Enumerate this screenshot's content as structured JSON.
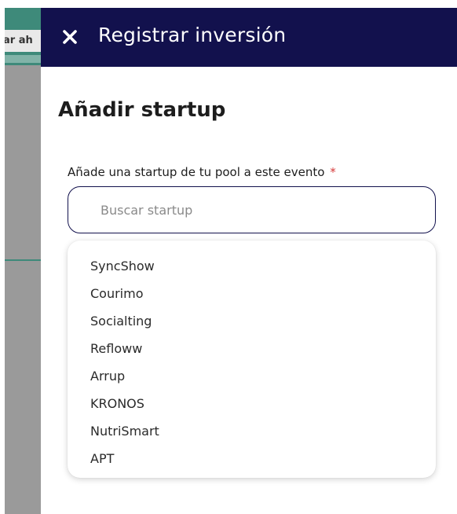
{
  "background": {
    "button_fragment": "ar ah"
  },
  "drawer": {
    "close_icon": "close-icon",
    "title": "Registrar inversión",
    "section_title": "Añadir startup",
    "field_label": "Añade una startup de tu pool a este evento",
    "required_marker": "*",
    "search": {
      "placeholder": "Buscar startup",
      "value": ""
    },
    "options": [
      {
        "label": "SyncShow"
      },
      {
        "label": "Courimo"
      },
      {
        "label": "Socialting"
      },
      {
        "label": "Refloww"
      },
      {
        "label": "Arrup"
      },
      {
        "label": "KRONOS"
      },
      {
        "label": "NutriSmart"
      },
      {
        "label": "APT"
      }
    ]
  },
  "colors": {
    "header_bg": "#12114d",
    "accent_green": "#3e8a7a",
    "required": "#d63a3a"
  }
}
